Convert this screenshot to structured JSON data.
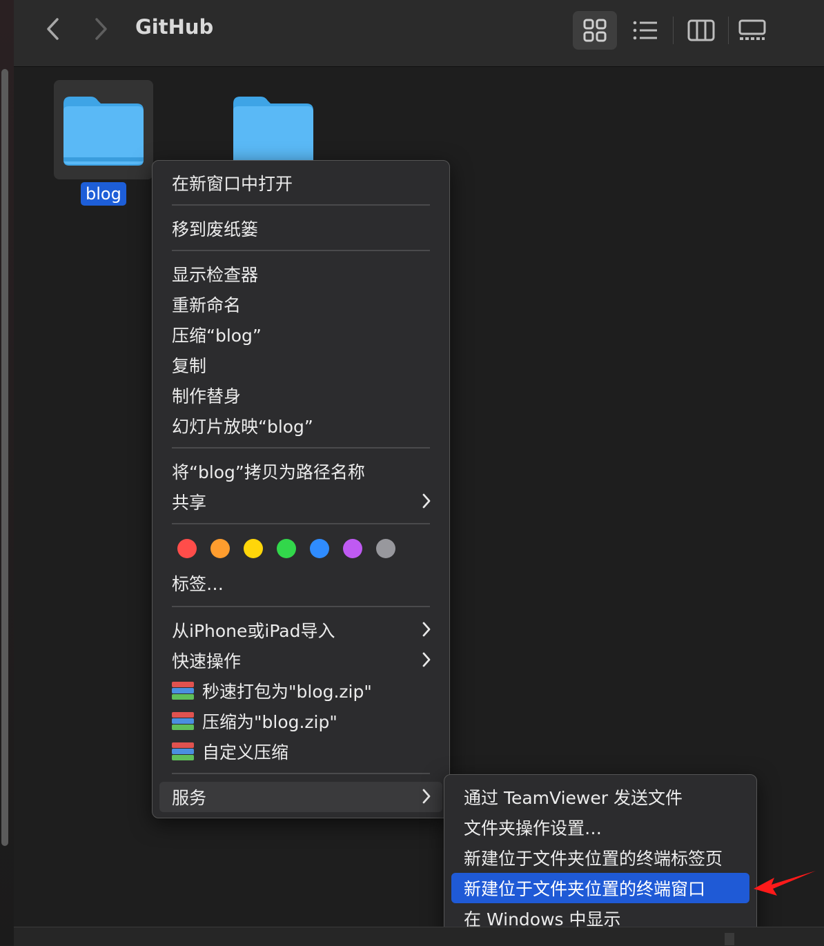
{
  "toolbar": {
    "back_symbol": "‹",
    "forward_symbol": "›",
    "title": "GitHub",
    "views": [
      "icon-view",
      "list-view",
      "column-view",
      "gallery-view"
    ]
  },
  "files": [
    {
      "name": "blog",
      "selected": true
    },
    {
      "name": "",
      "selected": false
    }
  ],
  "context_menu": {
    "open_new_window": "在新窗口中打开",
    "move_to_trash": "移到废纸篓",
    "get_info": "显示检查器",
    "rename": "重新命名",
    "compress": "压缩“blog”",
    "duplicate": "复制",
    "make_alias": "制作替身",
    "slideshow": "幻灯片放映“blog”",
    "copy_path": "将“blog”拷贝为路径名称",
    "share": "共享",
    "tags_label": "标签…",
    "tag_colors": [
      "#ff4d4a",
      "#ff9d2e",
      "#ffd60a",
      "#32d74b",
      "#2f8cff",
      "#bf5af2",
      "#98989d"
    ],
    "import_iphone": "从iPhone或iPad导入",
    "quick_actions": "快速操作",
    "quick_zip": "秒速打包为\"blog.zip\"",
    "compress_zip": "压缩为\"blog.zip\"",
    "custom_compress": "自定义压缩",
    "services": "服务"
  },
  "services_menu": {
    "teamviewer": "通过 TeamViewer 发送文件",
    "folder_actions": "文件夹操作设置…",
    "new_terminal_tab": "新建位于文件夹位置的终端标签页",
    "new_terminal_window": "新建位于文件夹位置的终端窗口",
    "show_in_windows": "在 Windows 中显示"
  },
  "colors": {
    "selection": "#1f5ad6",
    "folder": "#56b8f5",
    "annotation_arrow": "#ff1a1a"
  }
}
